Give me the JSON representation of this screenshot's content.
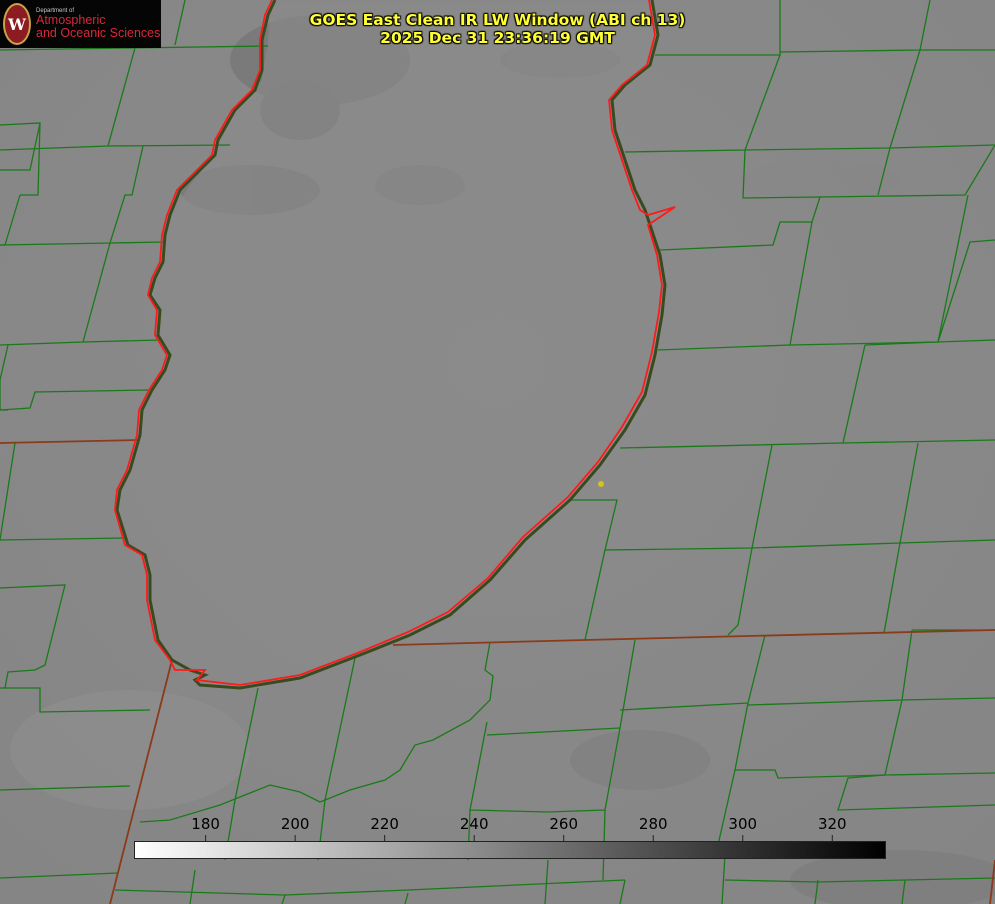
{
  "title_line1": "GOES East Clean IR LW Window (ABI ch 13)",
  "title_line2": "2025 Dec 31 23:36:19 GMT",
  "logo": {
    "department_label": "Department of",
    "line1": "Atmospheric",
    "line2": "and Oceanic Sciences",
    "crest_letter": "W"
  },
  "colorbar": {
    "ticks": [
      "180",
      "200",
      "220",
      "240",
      "260",
      "280",
      "300",
      "320"
    ],
    "tick_values": [
      180,
      200,
      220,
      240,
      260,
      280,
      300,
      320
    ],
    "range": [
      164,
      332
    ],
    "color_low": "#ffffff",
    "color_high": "#000000"
  },
  "colors": {
    "title": "#ffff33",
    "county_lines": "#1a7a1a",
    "state_lines": "#8b3a1a",
    "lake_outline": "#ff1a1a",
    "marker": "#d6c21a",
    "background_gray": "#8a8a8a"
  }
}
